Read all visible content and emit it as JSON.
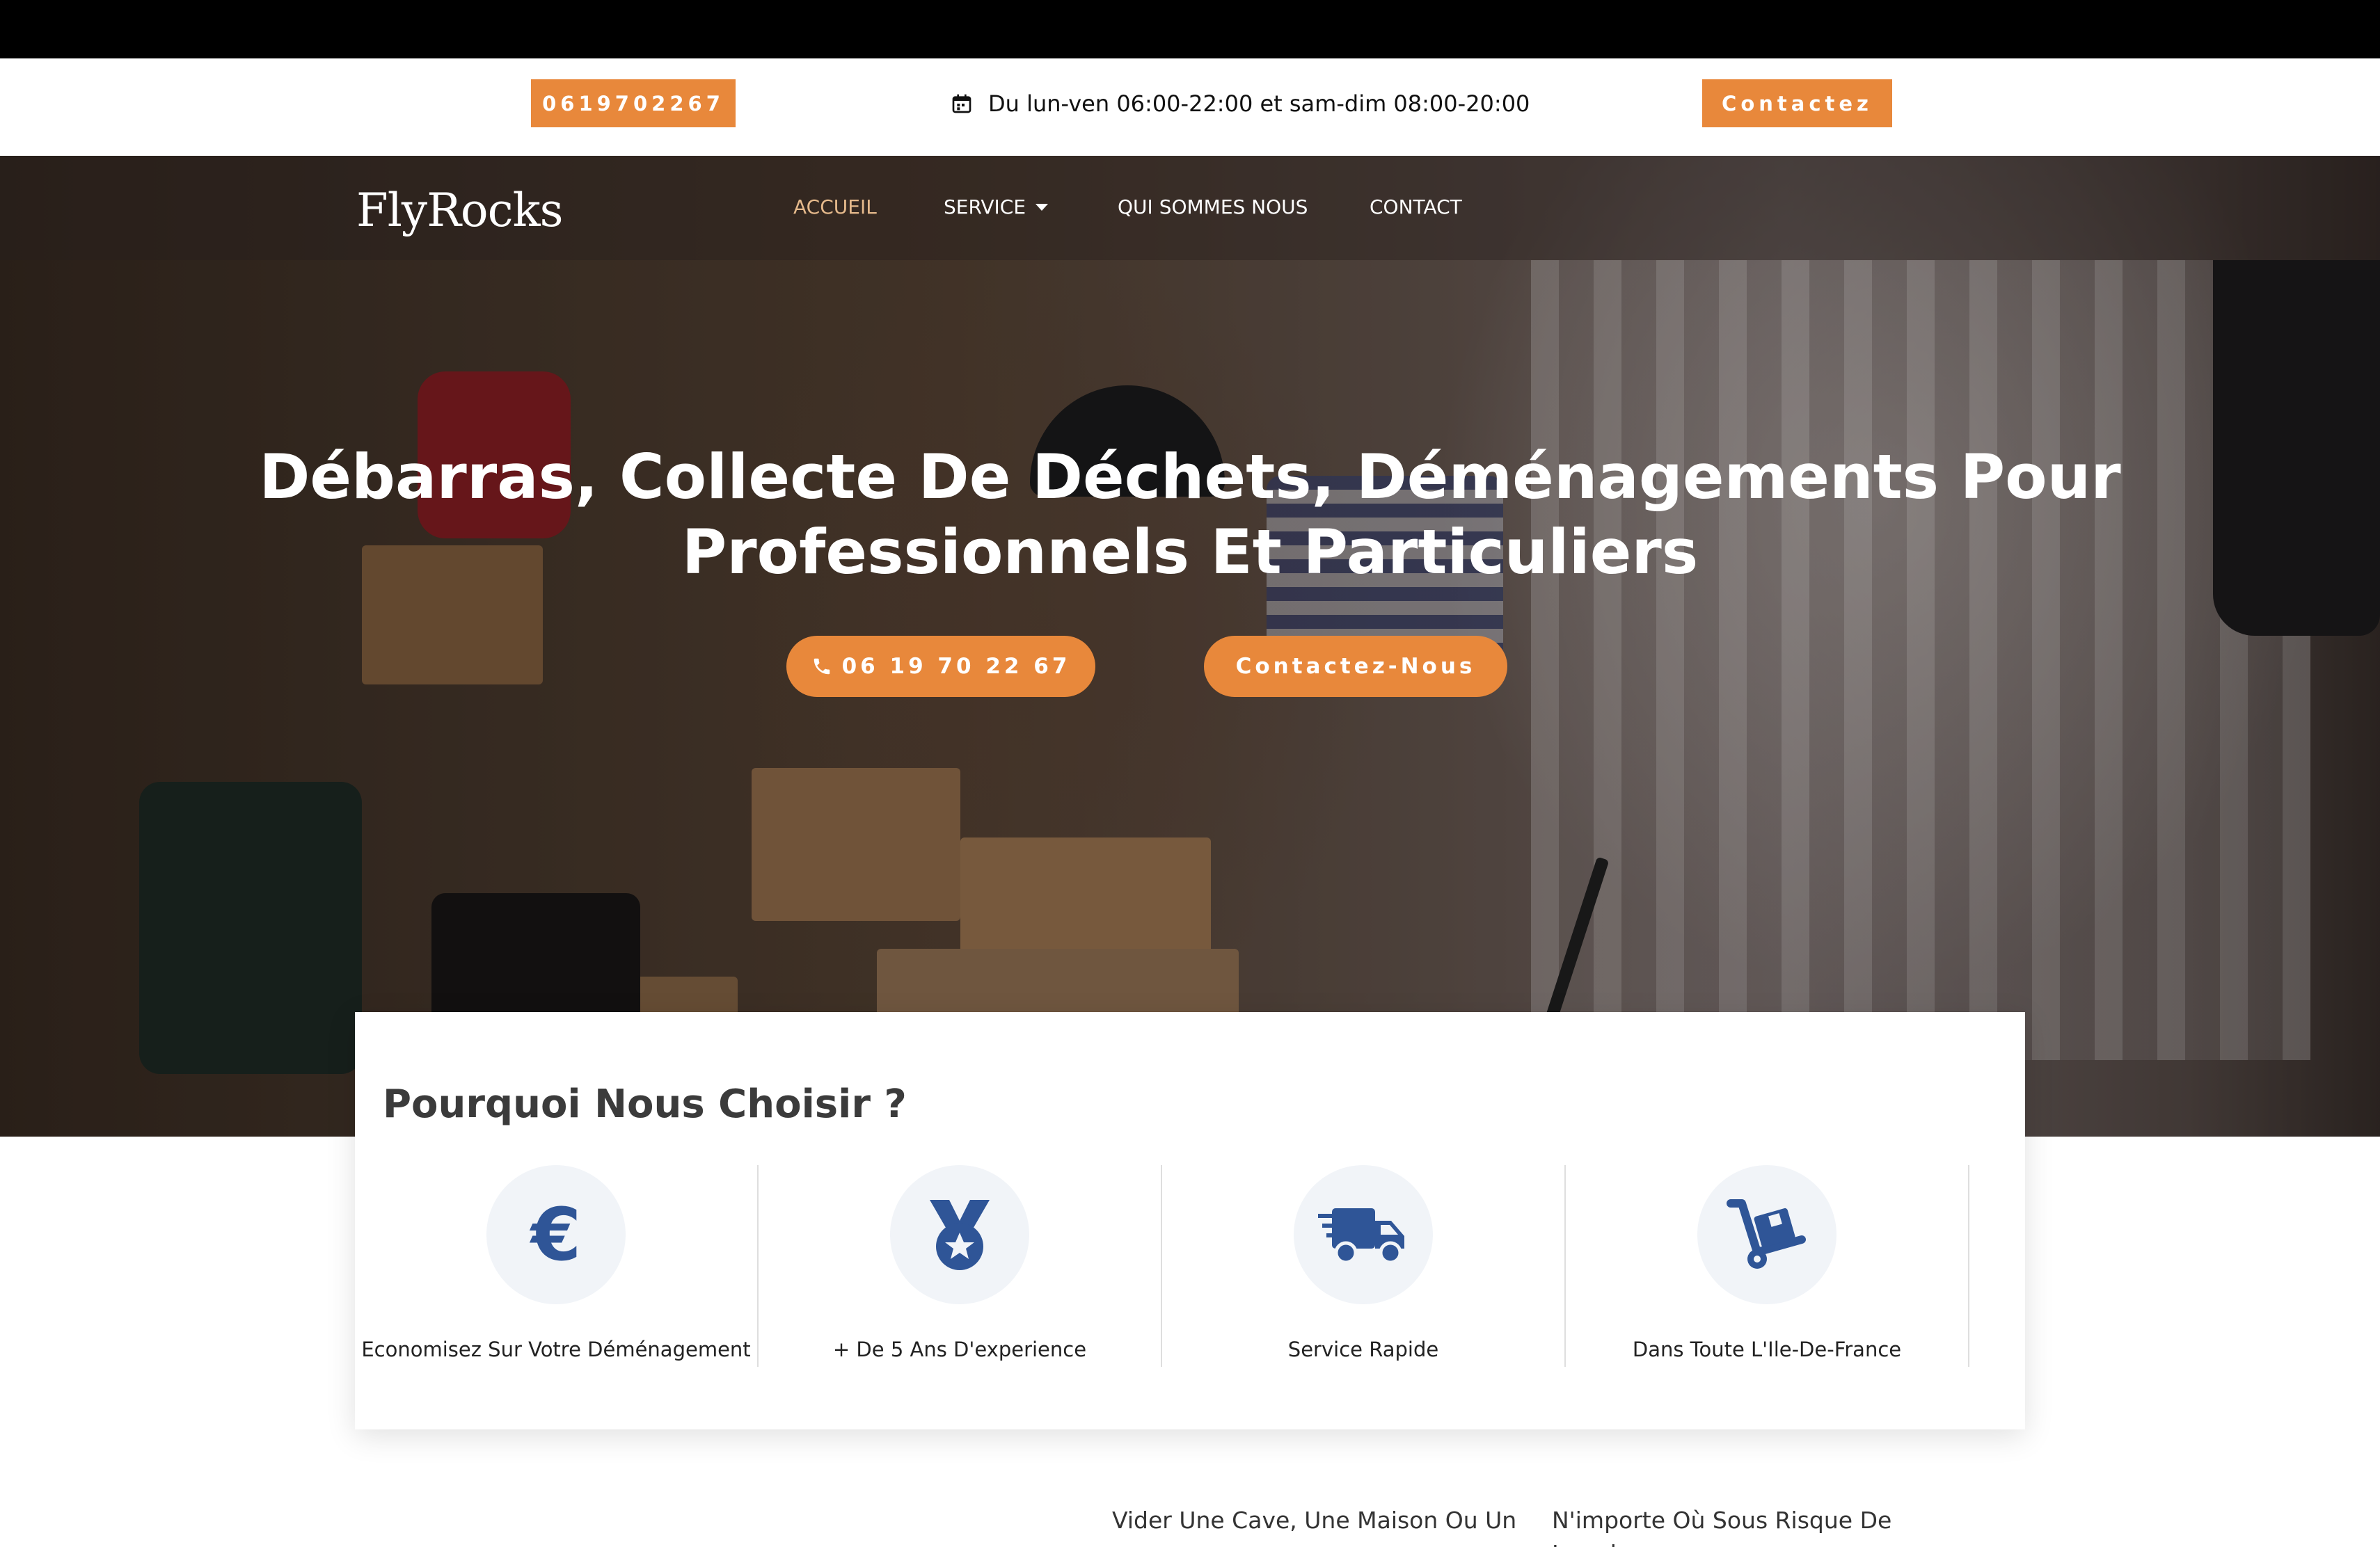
{
  "topbar": {
    "phone": "0619702267",
    "hours": "Du lun-ven 06:00-22:00 et sam-dim 08:00-20:00",
    "contact": "Contactez"
  },
  "nav": {
    "logo": "FlyRocks",
    "items": [
      "ACCUEIL",
      "SERVICE",
      "QUI SOMMES NOUS",
      "CONTACT"
    ]
  },
  "hero": {
    "title_line1": "Débarras, Collecte De Déchets, Déménagements Pour",
    "title_line2": "Professionnels Et Particuliers",
    "phone_button": "06 19 70 22 67",
    "contact_button": "Contactez-Nous"
  },
  "why": {
    "title": "Pourquoi Nous Choisir ?",
    "features": [
      {
        "icon": "euro-icon",
        "label": "Economisez Sur Votre Déménagement"
      },
      {
        "icon": "medal-icon",
        "label": "+ De 5 Ans D'experience"
      },
      {
        "icon": "truck-icon",
        "label": "Service Rapide"
      },
      {
        "icon": "dolly-icon",
        "label": "Dans Toute L'Ile-De-France"
      }
    ]
  },
  "bottom": {
    "col1": "Vider Une Cave, Une Maison Ou Un",
    "col2": "N'importe Où Sous Risque De Lourdes"
  },
  "colors": {
    "accent": "#e8883b",
    "icon_blue": "#2f5597",
    "active_nav": "#e5b98b"
  }
}
